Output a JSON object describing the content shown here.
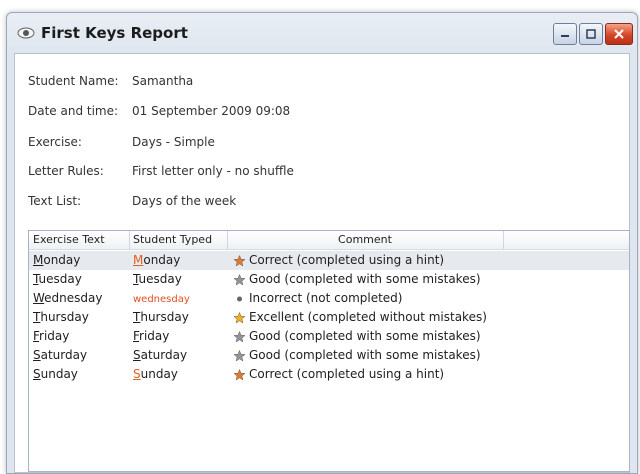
{
  "window": {
    "title": "First Keys Report"
  },
  "info": {
    "student_name_label": "Student Name:",
    "student_name": "Samantha",
    "date_label": "Date and time:",
    "date": "01 September 2009 09:08",
    "exercise_label": "Exercise:",
    "exercise": "Days - Simple",
    "letter_rules_label": "Letter Rules:",
    "letter_rules": "First letter only - no shuffle",
    "text_list_label": "Text List:",
    "text_list": "Days of the week"
  },
  "table": {
    "columns": [
      "Exercise Text",
      "Student Typed",
      "Comment"
    ],
    "rows": [
      {
        "text_first": "M",
        "text_rest": "onday",
        "typed_first": "M",
        "typed_rest": "onday",
        "comment": "Correct (completed using a hint)",
        "icon": "bronze-star-icon"
      },
      {
        "text_first": "T",
        "text_rest": "uesday",
        "typed_first": "T",
        "typed_rest": "uesday",
        "comment": "Good (completed with some mistakes)",
        "icon": "silver-star-icon"
      },
      {
        "text_first": "W",
        "text_rest": "ednesday",
        "typed_first": "",
        "typed_rest": "wednesday",
        "comment": "Incorrect (not completed)",
        "icon": "dot-icon"
      },
      {
        "text_first": "T",
        "text_rest": "hursday",
        "typed_first": "T",
        "typed_rest": "hursday",
        "comment": "Excellent (completed without mistakes)",
        "icon": "gold-star-icon"
      },
      {
        "text_first": "F",
        "text_rest": "riday",
        "typed_first": "F",
        "typed_rest": "riday",
        "comment": "Good (completed with some mistakes)",
        "icon": "silver-star-icon"
      },
      {
        "text_first": "S",
        "text_rest": "aturday",
        "typed_first": "S",
        "typed_rest": "aturday",
        "comment": "Good (completed with some mistakes)",
        "icon": "silver-star-icon"
      },
      {
        "text_first": "S",
        "text_rest": "unday",
        "typed_first": "S",
        "typed_rest": "unday",
        "comment": "Correct (completed using a hint)",
        "icon": "bronze-star-icon"
      }
    ]
  },
  "colors": {
    "gold_star": "#f0b020",
    "silver_star": "#8c96a4",
    "bronze_star": "#e07a30",
    "error_text": "#e05020",
    "selected_row": "#e6e9ee"
  }
}
